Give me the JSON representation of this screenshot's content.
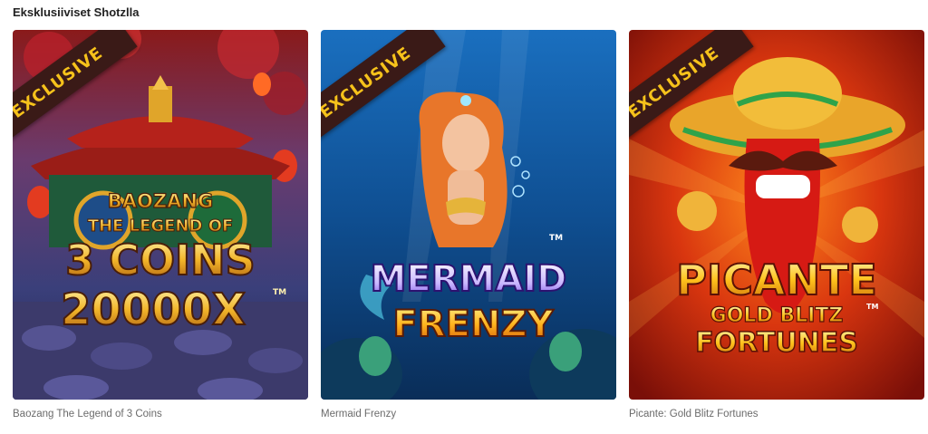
{
  "section": {
    "title": "Eksklusiiviset Shotzlla"
  },
  "badge": {
    "label": "EXCLUSIVE",
    "color": "#f6c21b",
    "bg": "#3a1a17"
  },
  "cards": [
    {
      "name": "Baozang The Legend of 3 Coins",
      "art": {
        "line1": "BAOZANG",
        "line2": "THE LEGEND OF",
        "line3": "3 COINS",
        "line4": "20000X",
        "tm": "TM"
      }
    },
    {
      "name": "Mermaid Frenzy",
      "art": {
        "line1": "MERMAID",
        "line2": "FRENZY",
        "tm": "TM"
      }
    },
    {
      "name": "Picante: Gold Blitz Fortunes",
      "art": {
        "line1": "PICANTE",
        "line2": "GOLD BLITZ",
        "line3": "FORTUNES",
        "tm": "TM"
      }
    }
  ]
}
